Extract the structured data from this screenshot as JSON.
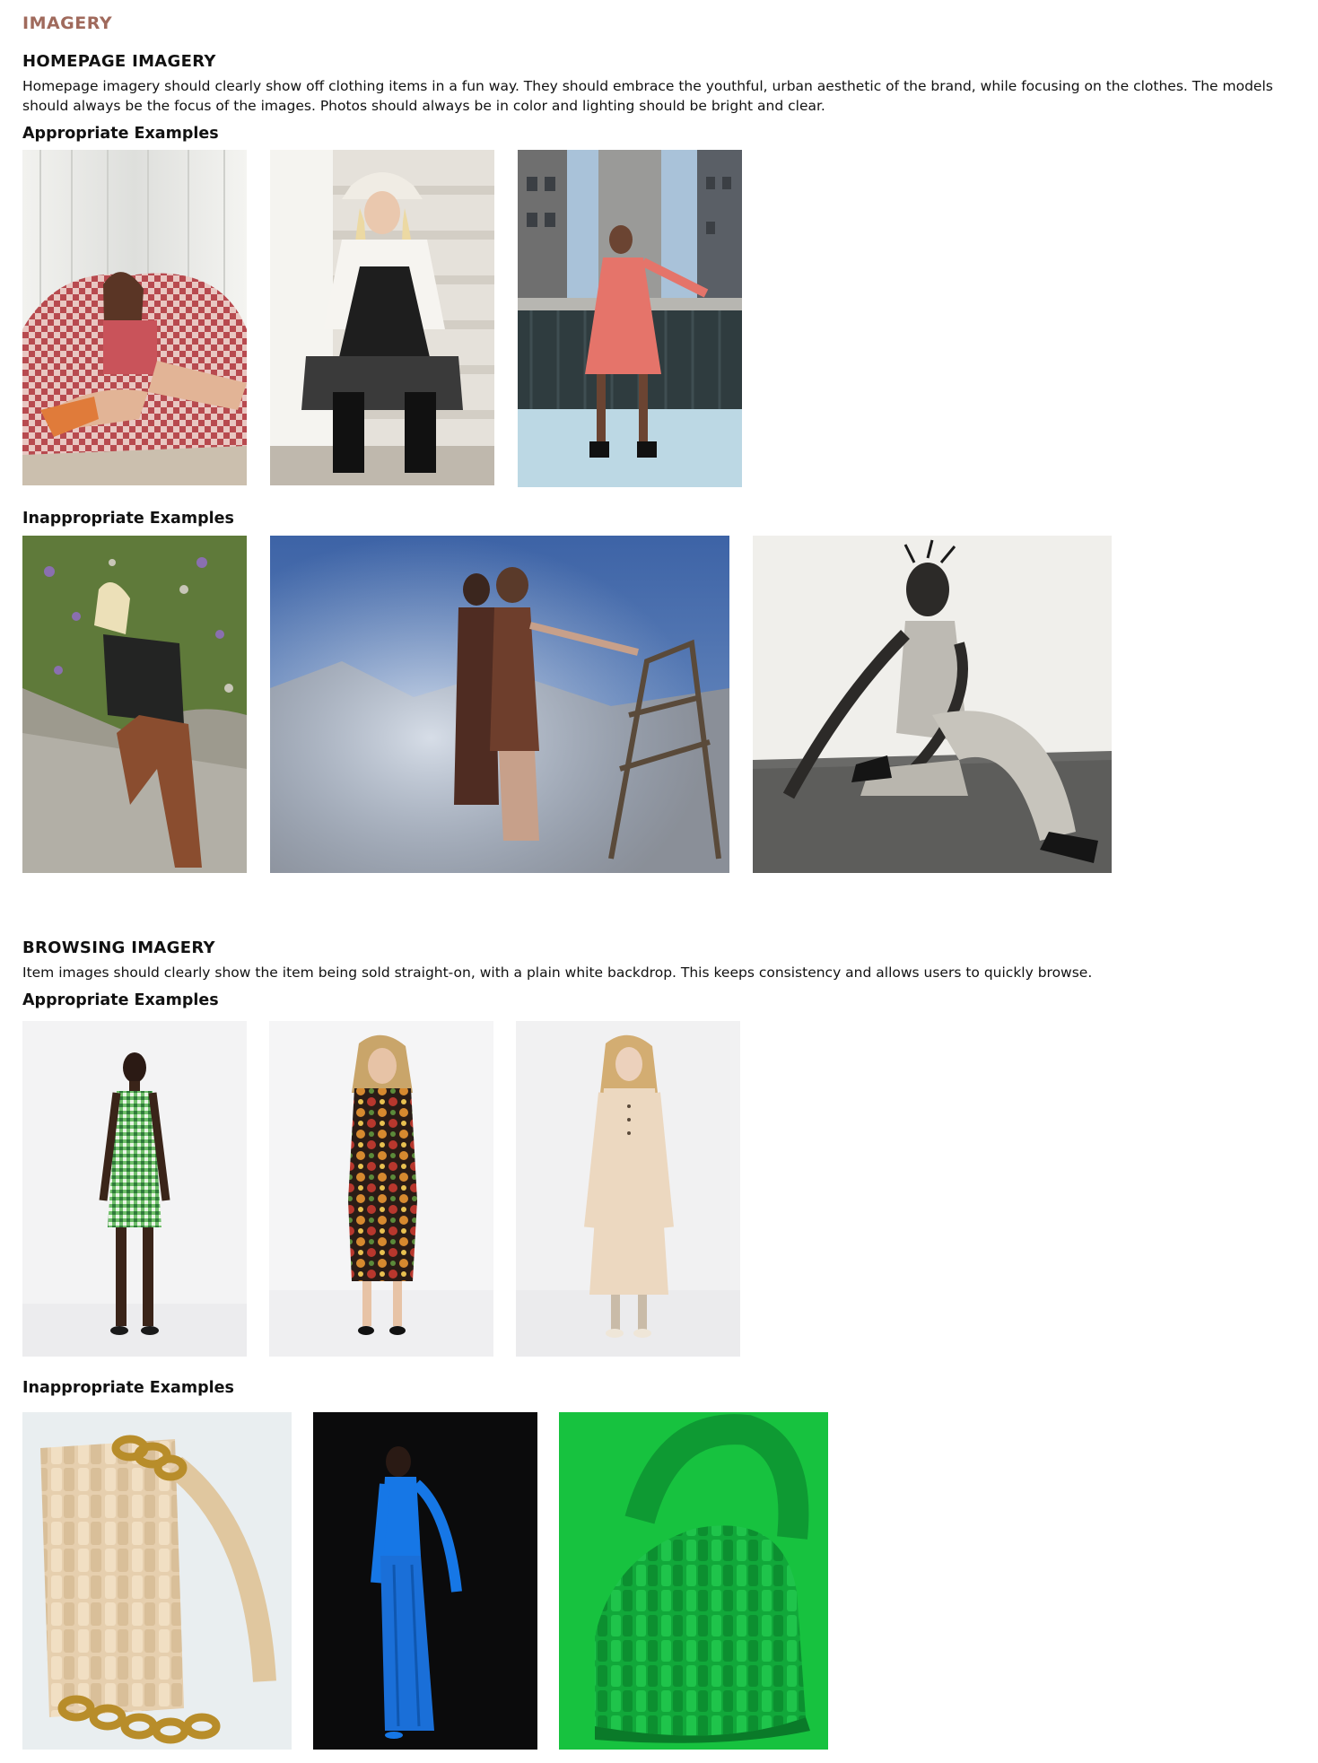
{
  "page_label": "IMAGERY",
  "homepage": {
    "title": "HOMEPAGE IMAGERY",
    "description": "Homepage imagery should clearly show off clothing items in a fun way. They should embrace the youthful, urban aesthetic of the brand, while focusing on the clothes. The models should always be the focus of the images. Photos should always be in color and lighting should be bright and clear.",
    "appropriate_label": "Appropriate Examples",
    "inappropriate_label": "Inappropriate Examples",
    "appropriate_images": [
      {
        "name": "model-checkered-chair-photo"
      },
      {
        "name": "model-bucket-hat-stairs-photo"
      },
      {
        "name": "model-pink-dress-rooftop-photo"
      }
    ],
    "inappropriate_images": [
      {
        "name": "model-leaning-flowers-photo"
      },
      {
        "name": "models-smoke-desert-photo"
      },
      {
        "name": "model-black-white-seated-photo"
      }
    ]
  },
  "browsing": {
    "title": "BROWSING IMAGERY",
    "description": "Item images should clearly show the item being sold straight-on, with a plain white backdrop. This keeps consistency and allows users to quickly browse.",
    "appropriate_label": "Appropriate Examples",
    "inappropriate_label": "Inappropriate Examples",
    "appropriate_images": [
      {
        "name": "model-green-gingham-dress-photo"
      },
      {
        "name": "model-printed-jumpsuit-photo"
      },
      {
        "name": "model-cream-knit-dress-photo"
      }
    ],
    "inappropriate_images": [
      {
        "name": "woven-bag-chain-closeup-photo"
      },
      {
        "name": "model-blue-dress-black-backdrop-photo"
      },
      {
        "name": "green-woven-bag-green-backdrop-photo"
      }
    ]
  }
}
